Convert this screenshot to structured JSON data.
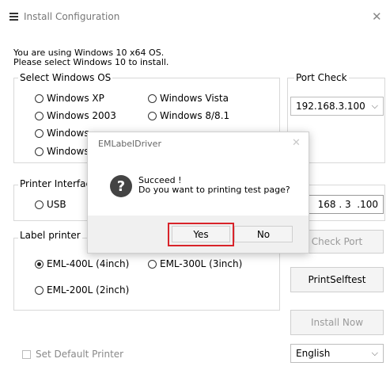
{
  "window": {
    "title": "Install Configuration",
    "intro_line1": "You are using Windows 10 x64 OS.",
    "intro_line2": "Please select Windows 10 to install."
  },
  "os_group": {
    "legend": "Select Windows OS",
    "options": [
      {
        "label": "Windows XP",
        "selected": false
      },
      {
        "label": "Windows Vista",
        "selected": false
      },
      {
        "label": "Windows 2003",
        "selected": false
      },
      {
        "label": "Windows 8/8.1",
        "selected": false
      },
      {
        "label": "Windows",
        "selected": false
      },
      {
        "label": "Windows",
        "selected": false
      }
    ]
  },
  "port_check": {
    "legend": "Port Check",
    "selected_ip": "192.168.3.100",
    "ip_field_value": "168 . 3  .100",
    "check_port_label": "Check Port"
  },
  "printer_interface": {
    "legend": "Printer Interfac",
    "usb_label": "USB"
  },
  "label_printer": {
    "legend": "Label printer",
    "options": [
      {
        "label": "EML-400L (4inch)",
        "selected": true
      },
      {
        "label": "EML-300L (3inch)",
        "selected": false
      },
      {
        "label": "EML-200L (2inch)",
        "selected": false
      }
    ]
  },
  "buttons": {
    "print_selftest": "PrintSelftest",
    "install_now": "Install Now"
  },
  "footer": {
    "default_printer_label": "Set Default Printer",
    "language": "English"
  },
  "dialog": {
    "title": "EMLabelDriver",
    "message_line1": "Succeed !",
    "message_line2": "Do you want to printing test page?",
    "yes_label": "Yes",
    "no_label": "No",
    "highlight_color": "#d8232a"
  }
}
